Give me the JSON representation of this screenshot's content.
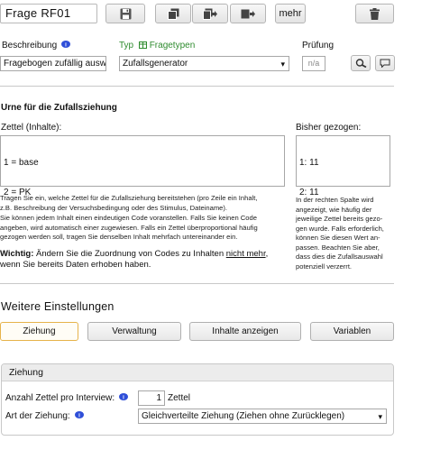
{
  "header": {
    "title": "Frage RF01",
    "more_label": "mehr"
  },
  "fields": {
    "description_label": "Beschreibung",
    "description_value": "Fragebogen zufällig auswä",
    "type_label": "Typ",
    "type_link": "Fragetypen",
    "type_value": "Zufallsgenerator",
    "check_label": "Prüfung",
    "check_value": "n/a"
  },
  "urn": {
    "heading": "Urne für die Zufallsziehung",
    "slips_label": "Zettel (Inhalte):",
    "slips_lines": [
      "1 = base",
      "2 = PK"
    ],
    "drawn_label": "Bisher gezogen:",
    "drawn_lines": [
      "1: 11",
      "2: 11"
    ],
    "help_left": [
      "Tragen Sie ein, welche Zettel für die Zufallsziehung bereitstehen (pro Zeile ein Inhalt,",
      "z.B. Beschreibung der Versuchsbedingung oder des Stimulus, Dateiname).",
      "Sie können jedem Inhalt einen eindeutigen Code voranstellen. Falls Sie keinen Code",
      "angeben, wird automatisch einer zugewiesen. Falls ein Zettel überproportional häufig",
      "gezogen werden soll, tragen Sie denselben Inhalt mehrfach untereinander ein."
    ],
    "warning_label": "Wichtig:",
    "warning_text_1": " Ändern Sie die Zuordnung von Codes zu Inhalten ",
    "warning_underlined": "nicht mehr",
    "warning_text_2": ",",
    "warning_line_2": "wenn Sie bereits Daten erhoben haben.",
    "help_right": [
      "In der rechten Spalte wird",
      "angezeigt, wie häufig der",
      "jeweilige Zettel bereits gezo-",
      "gen wurde. Falls erforderlich,",
      "können Sie diesen Wert an-",
      "passen. Beachten Sie aber,",
      "dass dies die Zufallsauswahl",
      "potenziell verzerrt."
    ]
  },
  "settings": {
    "heading": "Weitere Einstellungen",
    "tabs": [
      "Ziehung",
      "Verwaltung",
      "Inhalte anzeigen",
      "Variablen"
    ],
    "panel_title": "Ziehung",
    "count_label": "Anzahl Zettel pro Interview:",
    "count_value": "1",
    "count_unit": "Zettel",
    "mode_label": "Art der Ziehung:",
    "mode_value": "Gleichverteilte Ziehung (Ziehen ohne Zurücklegen)"
  },
  "colors": {
    "accent_orange": "#e6b34a",
    "link_green": "#2e8b2e",
    "info_blue": "#2f4fd8"
  }
}
